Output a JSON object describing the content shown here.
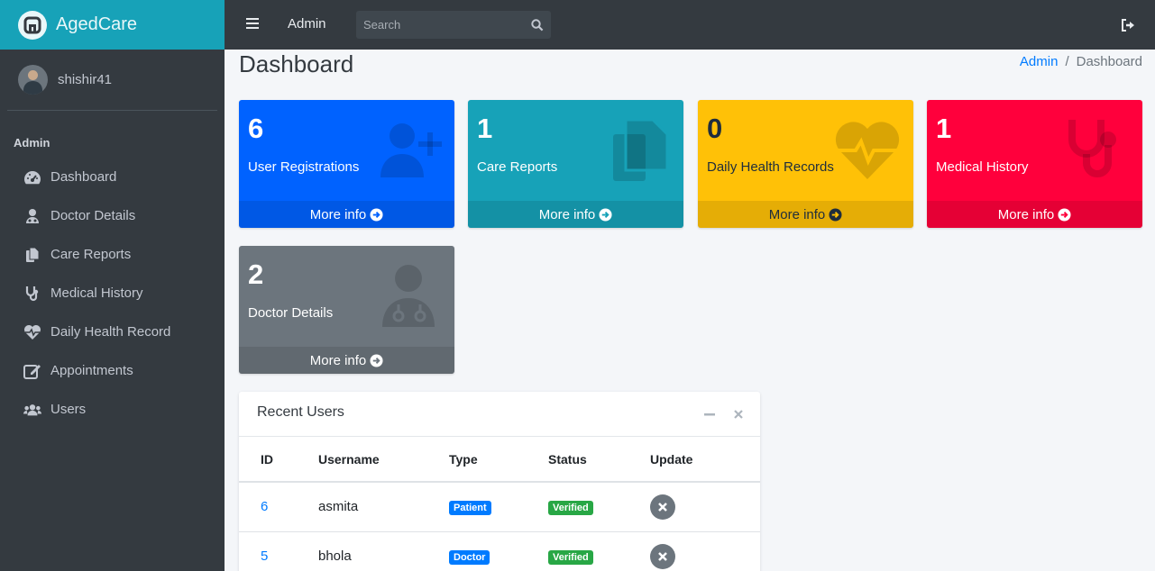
{
  "app": {
    "brand": "AgedCare"
  },
  "sidebar": {
    "user": "shishir41",
    "header": "Admin",
    "items": [
      {
        "label": "Dashboard",
        "icon": "tachometer-icon"
      },
      {
        "label": "Doctor Details",
        "icon": "user-doctor-icon"
      },
      {
        "label": "Care Reports",
        "icon": "copy-icon"
      },
      {
        "label": "Medical History",
        "icon": "stethoscope-icon"
      },
      {
        "label": "Daily Health Record",
        "icon": "heartbeat-icon"
      },
      {
        "label": "Appointments",
        "icon": "edit-icon"
      },
      {
        "label": "Users",
        "icon": "users-icon"
      }
    ]
  },
  "topbar": {
    "title": "Admin",
    "search_placeholder": "Search"
  },
  "page": {
    "title": "Dashboard",
    "breadcrumb": [
      "Admin",
      "Dashboard"
    ]
  },
  "boxes": [
    {
      "count": "6",
      "label": "User Registrations",
      "footer": "More info",
      "color": "#0062ff",
      "icon": "user-plus-icon"
    },
    {
      "count": "1",
      "label": "Care Reports",
      "footer": "More info",
      "color": "#17a2b8",
      "icon": "copy-icon"
    },
    {
      "count": "0",
      "label": "Daily Health Records",
      "footer": "More info",
      "color": "#ffc107",
      "icon": "heartbeat-icon"
    },
    {
      "count": "1",
      "label": "Medical History",
      "footer": "More info",
      "color": "#ff003c",
      "icon": "stethoscope-icon"
    },
    {
      "count": "2",
      "label": "Doctor Details",
      "footer": "More info",
      "color": "#6c757d",
      "icon": "user-doctor-icon"
    }
  ],
  "recent_users": {
    "title": "Recent Users",
    "columns": [
      "ID",
      "Username",
      "Type",
      "Status",
      "Update"
    ],
    "rows": [
      {
        "id": "6",
        "username": "asmita",
        "type": "Patient",
        "status": "Verified"
      },
      {
        "id": "5",
        "username": "bhola",
        "type": "Doctor",
        "status": "Verified"
      }
    ]
  },
  "colors": {
    "primary": "#007bff",
    "success": "#28a745",
    "sidebar": "#343a40",
    "brand": "#17a2b8"
  }
}
